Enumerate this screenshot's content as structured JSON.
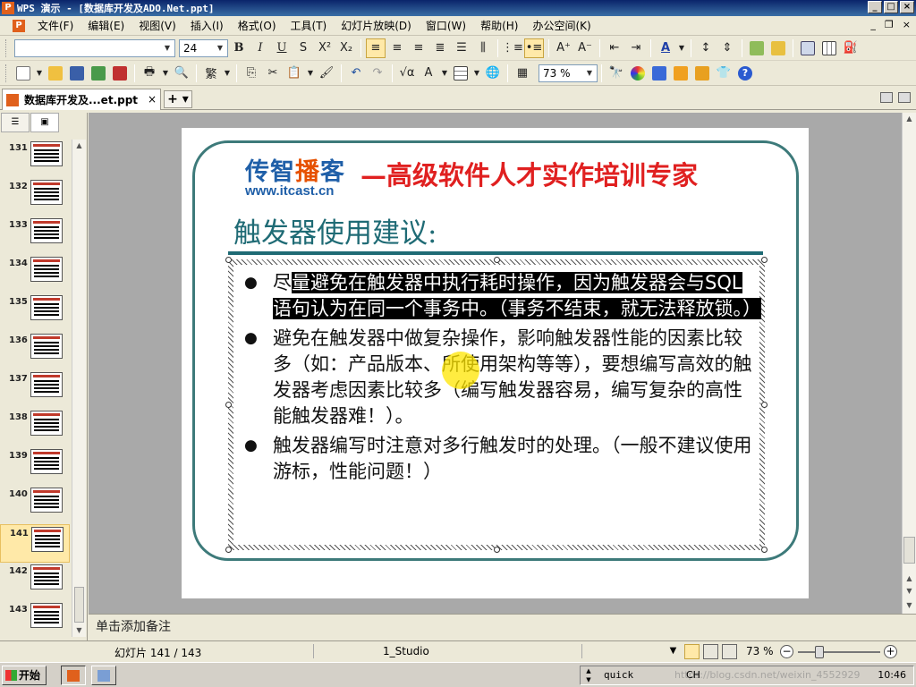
{
  "window": {
    "title": "WPS 演示 - [数据库开发及ADO.Net.ppt]",
    "minimize": "_",
    "maximize": "□",
    "close": "×"
  },
  "menu": {
    "items": [
      "文件(F)",
      "编辑(E)",
      "视图(V)",
      "插入(I)",
      "格式(O)",
      "工具(T)",
      "幻灯片放映(D)",
      "窗口(W)",
      "帮助(H)",
      "办公空间(K)"
    ],
    "mdi_min": "_",
    "mdi_restore": "❐",
    "mdi_close": "×"
  },
  "format_toolbar": {
    "font_name": "",
    "font_size": "24",
    "bold": "B",
    "italic": "I",
    "underline": "U",
    "shadow": "S",
    "superscript": "X²",
    "subscript": "X₂"
  },
  "standard_toolbar": {
    "zoom": "73 %"
  },
  "doc_tab": {
    "label": "数据库开发及...et.ppt",
    "close": "×",
    "new": "+ ▾"
  },
  "thumbnails": {
    "items": [
      {
        "num": "131"
      },
      {
        "num": "132"
      },
      {
        "num": "133"
      },
      {
        "num": "134"
      },
      {
        "num": "135"
      },
      {
        "num": "136"
      },
      {
        "num": "137"
      },
      {
        "num": "138"
      },
      {
        "num": "139"
      },
      {
        "num": "140"
      },
      {
        "num": "141"
      },
      {
        "num": "142"
      },
      {
        "num": "143"
      }
    ],
    "selected": "141"
  },
  "slide": {
    "logo_part1": "传智",
    "logo_part2": "播",
    "logo_part3": "客",
    "logo_url": "www.itcast.cn",
    "slogan": "—高级软件人才实作培训专家",
    "title": "触发器使用建议:",
    "bullets": [
      {
        "pre": "尽",
        "selected": "量避免在触发器中执行耗时操作，因为触发器会与SQL语句认为在同一个事务中。（事务不结束，就无法释放锁。）",
        "post": ""
      },
      {
        "pre": "避免在触发器中做复杂操作，影响触发器性能的因素比较多（如：产品版本、所使用架构等等），要想编写高效的触发器考虑因素比较多（编写触发器容易，编写复杂的高性能触发器难！）。",
        "selected": "",
        "post": ""
      },
      {
        "pre": "触发器编写时注意对多行触发时的处理。（一般不建议使用游标，性能问题！）",
        "selected": "",
        "post": ""
      }
    ]
  },
  "notes": {
    "placeholder": "单击添加备注"
  },
  "status": {
    "slide": "幻灯片 141 / 143",
    "theme": "1_Studio",
    "zoom": "73 %",
    "zoom_level_percent": 73
  },
  "taskbar": {
    "start": "开始",
    "ime": "quick",
    "ime2": "CH",
    "clock": "10:46",
    "watermark": "https://blog.csdn.net/weixin_4552929"
  },
  "colors": {
    "title_teal": "#1f6b75",
    "slogan_red": "#e02020",
    "logo_blue": "#1f5fa8",
    "logo_orange": "#e65100",
    "selection_highlight": "#ffe9a8"
  }
}
